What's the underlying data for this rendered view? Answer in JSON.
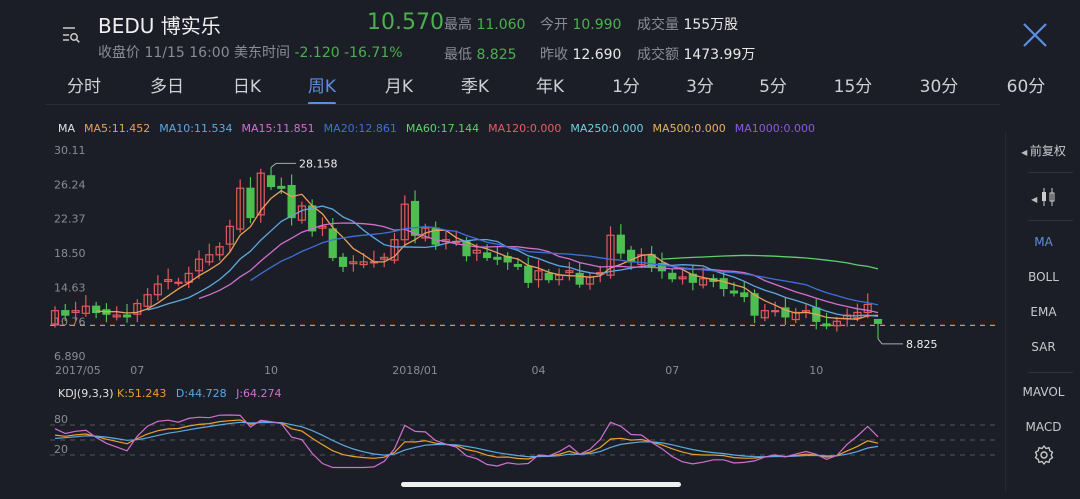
{
  "header": {
    "title": "BEDU 博实乐",
    "status": "收盘价",
    "datetime": "11/15 16:00 美东时间",
    "price": "10.570",
    "change": "-2.120",
    "change_pct": "-16.71%",
    "quotes": [
      {
        "label": "最高",
        "value": "11.060",
        "color": "green"
      },
      {
        "label": "今开",
        "value": "10.990",
        "color": "green"
      },
      {
        "label": "成交量",
        "value": "155万股",
        "color": "white"
      },
      {
        "label": "最低",
        "value": "8.825",
        "color": "green"
      },
      {
        "label": "昨收",
        "value": "12.690",
        "color": "white"
      },
      {
        "label": "成交额",
        "value": "1473.99万",
        "color": "white"
      }
    ]
  },
  "tabs": [
    "分时",
    "多日",
    "日K",
    "周K",
    "月K",
    "季K",
    "年K",
    "1分",
    "3分",
    "5分",
    "15分",
    "30分",
    "60分"
  ],
  "active_tab": "周K",
  "ma_legend": [
    {
      "text": "MA",
      "color": "#e0e0e0"
    },
    {
      "text": "MA5:11.452",
      "color": "#e8a05a"
    },
    {
      "text": "MA10:11.534",
      "color": "#5fa8e0"
    },
    {
      "text": "MA15:11.851",
      "color": "#d070d0"
    },
    {
      "text": "MA20:12.861",
      "color": "#3f6fd8"
    },
    {
      "text": "MA60:17.144",
      "color": "#5fd06a"
    },
    {
      "text": "MA120:0.000",
      "color": "#e06060"
    },
    {
      "text": "MA250:0.000",
      "color": "#6fd0e0"
    },
    {
      "text": "MA500:0.000",
      "color": "#e8b060"
    },
    {
      "text": "MA1000:0.000",
      "color": "#8a5ae0"
    }
  ],
  "yaxis": [
    "30.11",
    "26.24",
    "22.37",
    "18.50",
    "14.63",
    "10.76",
    "6.890"
  ],
  "xaxis": [
    {
      "label": "2017/05",
      "i": 0
    },
    {
      "label": "07",
      "i": 8
    },
    {
      "label": "10",
      "i": 21
    },
    {
      "label": "2018/01",
      "i": 35
    },
    {
      "label": "04",
      "i": 47
    },
    {
      "label": "07",
      "i": 60
    },
    {
      "label": "10",
      "i": 74
    }
  ],
  "annotations": {
    "high": "28.158",
    "low": "8.825"
  },
  "kdj": {
    "title": "KDJ(9,3,3)",
    "k": "K:51.243",
    "d": "D:44.728",
    "j": "J:64.274",
    "levels": [
      "80",
      "20"
    ]
  },
  "side_panel": {
    "adjust": "前复权",
    "items": [
      "MA",
      "BOLL",
      "EMA",
      "SAR",
      "MAVOL",
      "MACD"
    ],
    "active": "MA"
  },
  "colors": {
    "up": "#e05a5a",
    "down": "#4cbf50",
    "accent": "#5d8fe0"
  },
  "chart_data": {
    "type": "candlestick",
    "ylim": [
      6.89,
      30.11
    ],
    "current_price": 10.57,
    "high_index": 21,
    "high": 28.158,
    "low": 8.825,
    "closes": [
      12.0,
      11.5,
      12.0,
      12.5,
      11.8,
      11.6,
      11.5,
      11.3,
      12.8,
      13.8,
      15.0,
      15.5,
      15.2,
      16.2,
      17.8,
      18.3,
      19.2,
      21.5,
      25.8,
      22.5,
      27.5,
      26.0,
      25.8,
      22.5,
      23.8,
      21.0,
      21.5,
      18.0,
      17.0,
      17.5,
      17.5,
      17.5,
      18.0,
      20.0,
      24.0,
      20.5,
      21.3,
      19.5,
      20.0,
      19.8,
      18.2,
      18.8,
      18.0,
      17.8,
      17.5,
      17.0,
      15.2,
      16.5,
      15.5,
      16.0,
      16.5,
      15.0,
      15.8,
      16.3,
      20.5,
      18.5,
      17.5,
      18.3,
      17.0,
      16.5,
      15.6,
      15.8,
      15.2,
      15.6,
      15.3,
      14.5,
      14.0,
      13.6,
      11.5,
      12.0,
      12.0,
      11.3,
      11.8,
      12.0,
      10.8,
      10.3,
      10.8,
      11.5,
      11.8,
      12.7,
      10.57
    ]
  }
}
